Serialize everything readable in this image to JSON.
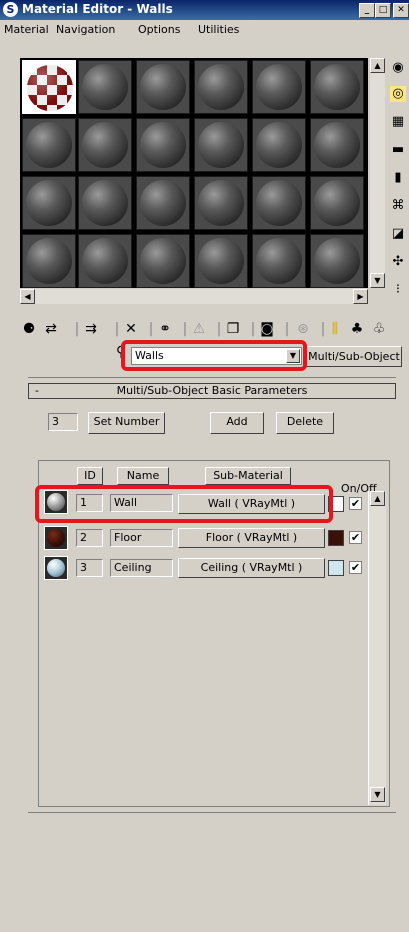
{
  "window": {
    "title": "Material Editor - Walls",
    "app_icon": "3ds-max-logo",
    "controls": [
      "minimize",
      "maximize",
      "close"
    ]
  },
  "menu": [
    "Material",
    "Navigation",
    "Options",
    "Utilities"
  ],
  "slots": {
    "rows": 4,
    "cols": 6,
    "active_index": 0
  },
  "side_tools": [
    "sample-type-icon",
    "backlight-icon",
    "background-icon",
    "sample-uv-tiling-icon",
    "video-color-check-icon",
    "make-preview-icon",
    "options-icon",
    "select-by-material-icon",
    "material-map-navigator-icon"
  ],
  "bottom_tools": [
    "get-material-icon",
    "put-to-scene-icon",
    "assign-material-icon",
    "reset-icon",
    "make-unique-icon",
    "put-to-library-icon",
    "material-effects-channel-icon",
    "show-map-in-viewport-icon",
    "show-end-result-icon",
    "go-to-parent-icon",
    "go-forward-to-sibling-icon"
  ],
  "material_name": "Walls",
  "material_type": "Multi/Sub-Object",
  "rollout": {
    "collapse": "-",
    "title": "Multi/Sub-Object Basic Parameters"
  },
  "set_number": {
    "value": "3",
    "label": "Set Number"
  },
  "add_label": "Add",
  "delete_label": "Delete",
  "columns": {
    "id": "ID",
    "name": "Name",
    "submaterial": "Sub-Material",
    "onoff": "On/Off"
  },
  "rows": [
    {
      "id": "1",
      "name": "Wall",
      "sub": "Wall  ( VRayMtl )",
      "swatch": "#ffffff",
      "ball": "grey",
      "on": "✔"
    },
    {
      "id": "2",
      "name": "Floor",
      "sub": "Floor  ( VRayMtl )",
      "swatch": "#3a1008",
      "ball": "dark-red",
      "on": "✔"
    },
    {
      "id": "3",
      "name": "Ceiling",
      "sub": "Ceiling  ( VRayMtl )",
      "swatch": "#cfe6f0",
      "ball": "light-blue",
      "on": "✔"
    }
  ],
  "highlight_color": "#e8141e"
}
